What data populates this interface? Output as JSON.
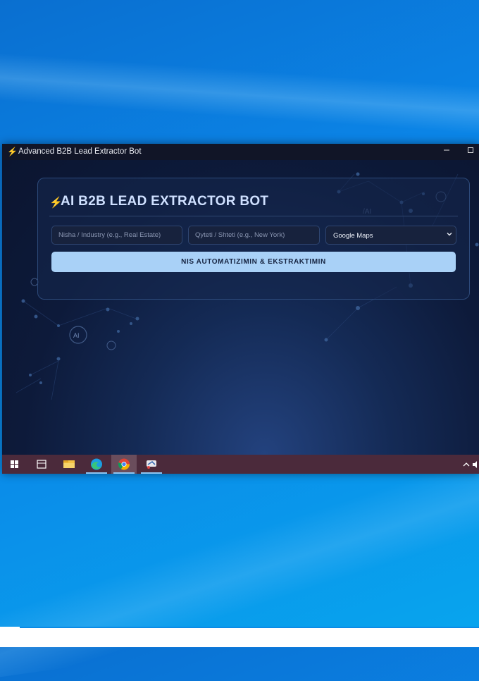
{
  "window": {
    "title": "Advanced B2B Lead Extractor Bot",
    "app_icon": "lightning-bolt",
    "controls": [
      "minimize",
      "maximize"
    ]
  },
  "app": {
    "heading": "AI B2B LEAD EXTRACTOR BOT",
    "heading_icon": "lightning-bolt",
    "niche_input": {
      "placeholder": "Nisha / Industry (e.g., Real Estate)",
      "value": ""
    },
    "city_input": {
      "placeholder": "Qyteti / Shteti (e.g., New York)",
      "value": ""
    },
    "source_select": {
      "selected": "Google Maps"
    },
    "action_button": "NIS AUTOMATIZIMIN & EKSTRAKTIMIN"
  },
  "taskbar": {
    "items": [
      "windows-start",
      "task-view",
      "file-explorer",
      "edge-browser",
      "chrome-browser",
      "python-app"
    ],
    "active": "chrome-browser"
  },
  "colors": {
    "accent_bolt": "#f5b632",
    "button_bg": "#a9d1f7",
    "taskbar_bg": "#4b2a3b",
    "app_bg": "#0f1933"
  }
}
